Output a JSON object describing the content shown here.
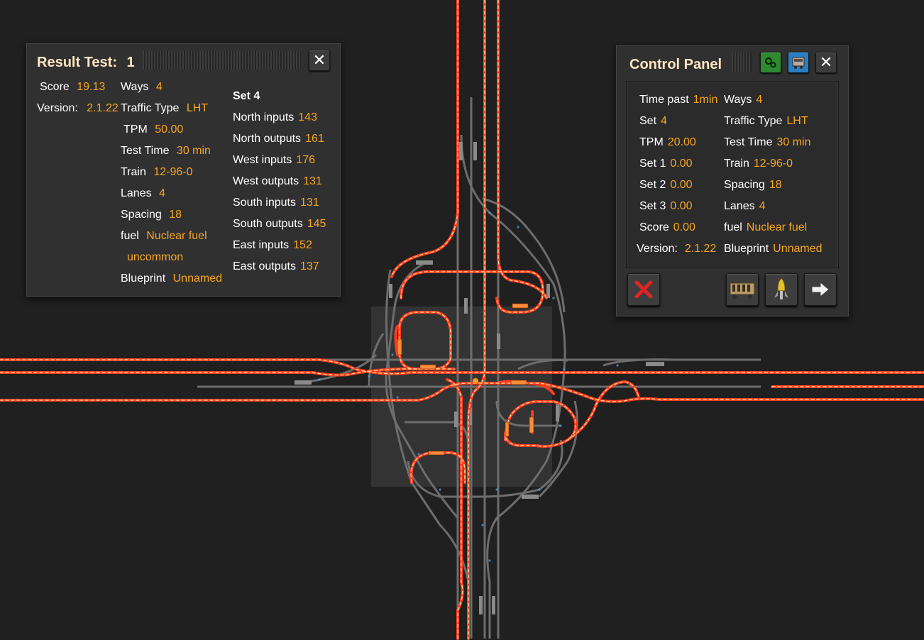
{
  "result_panel": {
    "title": "Result Test:",
    "test_number": "1",
    "close_icon": "close-icon",
    "score_label": "Score",
    "score_value": "19.13",
    "version_label": "Version:",
    "version_value": "2.1.22",
    "ways_label": "Ways",
    "ways_value": "4",
    "traffic_label": "Traffic Type",
    "traffic_value": "LHT",
    "tpm_label": "TPM",
    "tpm_value": "50.00",
    "test_time_label": "Test Time",
    "test_time_value": "30 min",
    "train_label": "Train",
    "train_value": "12-96-0",
    "lanes_label": "Lanes",
    "lanes_value": "4",
    "spacing_label": "Spacing",
    "spacing_value": "18",
    "fuel_label": "fuel",
    "fuel_value_line1": "Nuclear fuel",
    "fuel_value_line2": "uncommon",
    "blueprint_label": "Blueprint",
    "blueprint_value": "Unnamed",
    "set_heading": "Set 4",
    "stats": [
      {
        "label": "North inputs",
        "value": "143"
      },
      {
        "label": "North outputs",
        "value": "161"
      },
      {
        "label": "West inputs",
        "value": "176"
      },
      {
        "label": "West outputs",
        "value": "131"
      },
      {
        "label": "South inputs",
        "value": "131"
      },
      {
        "label": "South outputs",
        "value": "145"
      },
      {
        "label": "East inputs",
        "value": "152"
      },
      {
        "label": "East outputs",
        "value": "137"
      }
    ]
  },
  "control_panel": {
    "title": "Control Panel",
    "settings_icon": "gears-icon",
    "train_icon": "locomotive-icon",
    "close_icon": "close-icon",
    "left": [
      {
        "label": "Time past",
        "value": "1min"
      },
      {
        "label": "Set",
        "value": "4"
      },
      {
        "label": "TPM",
        "value": "20.00"
      },
      {
        "label": "Set 1",
        "value": "0.00"
      },
      {
        "label": "Set 2",
        "value": "0.00"
      },
      {
        "label": "Set 3",
        "value": "0.00"
      },
      {
        "label": "Score",
        "value": "0.00"
      },
      {
        "label": "Version:",
        "value": "2.1.22"
      }
    ],
    "right": [
      {
        "label": "Ways",
        "value": "4"
      },
      {
        "label": "Traffic Type",
        "value": "LHT"
      },
      {
        "label": "Test Time",
        "value": "30 min"
      },
      {
        "label": "Train",
        "value": "12-96-0"
      },
      {
        "label": "Spacing",
        "value": "18"
      },
      {
        "label": "Lanes",
        "value": "4"
      },
      {
        "label": "fuel",
        "value": "Nuclear fuel"
      },
      {
        "label": "Blueprint",
        "value": "Unnamed"
      }
    ],
    "footer_icons": [
      "cancel-icon",
      "train-wagons-icon",
      "rocket-icon",
      "next-arrow-icon"
    ]
  },
  "colors": {
    "background": "#202020",
    "value_orange": "#f5a623",
    "title_cream": "#ffe6c0",
    "rail_grey": "#6e6e6e",
    "signal_red": "#ff3b1f",
    "signal_blue": "#4aa8e6"
  }
}
